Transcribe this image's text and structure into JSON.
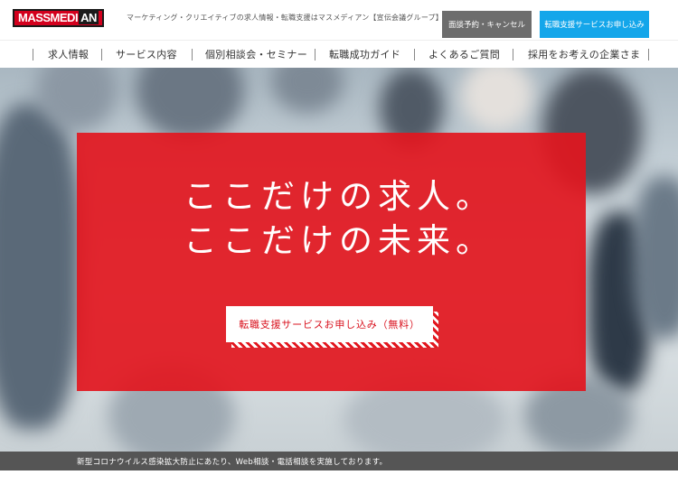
{
  "header": {
    "logo_text_main": "MASSMEDI",
    "logo_text_accent": "AN",
    "tagline": "マーケティング・クリエイティブの求人情報・転職支援はマスメディアン【宣伝会議グループ】",
    "booking_button": "面談予約・キャンセル",
    "apply_button": "転職支援サービスお申し込み"
  },
  "nav": {
    "items": [
      {
        "label": "求人情報"
      },
      {
        "label": "サービス内容"
      },
      {
        "label": "個別相談会・セミナー"
      },
      {
        "label": "転職成功ガイド"
      },
      {
        "label": "よくあるご質問"
      },
      {
        "label": "採用をお考えの企業さま"
      }
    ]
  },
  "hero": {
    "headline_line1": "ここだけの求人。",
    "headline_line2": "ここだけの未来。",
    "cta_label": "転職支援サービスお申し込み（無料）"
  },
  "notice": {
    "text": "新型コロナウイルス感染拡大防止にあたり、Web相談・電話相談を実施しております。"
  },
  "colors": {
    "brand_red": "#e2161e",
    "apply_blue": "#14a6ea",
    "booking_gray": "#6d6d6d",
    "notice_gray": "#555555"
  }
}
